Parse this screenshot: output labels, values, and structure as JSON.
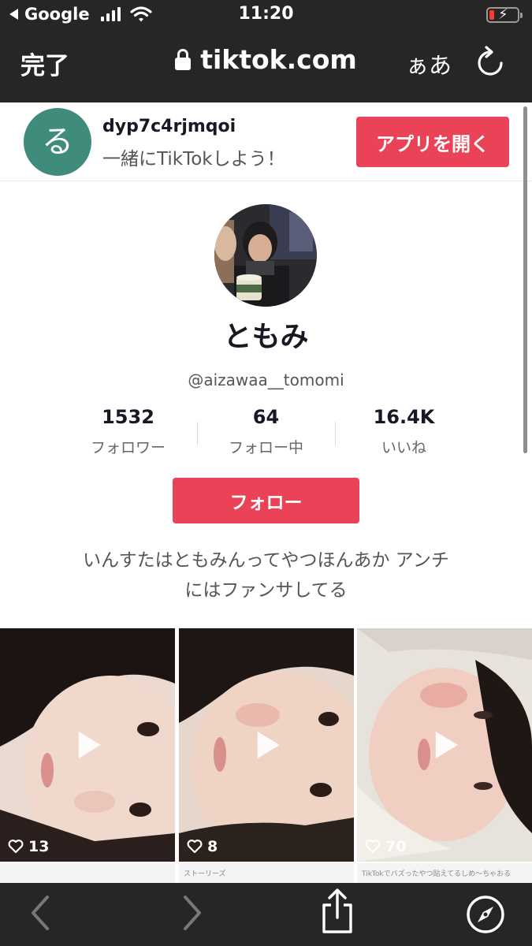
{
  "status_bar": {
    "back_app": "Google",
    "time": "11:20"
  },
  "safari": {
    "done_label": "完了",
    "url": "tiktok.com",
    "text_size_label": "ぁあ"
  },
  "banner": {
    "avatar_char": "る",
    "username": "dyp7c4rjmqoi",
    "subtitle": "一緒にTikTokしよう！",
    "open_app_label": "アプリを開く"
  },
  "profile": {
    "name": "ともみ",
    "handle": "@aizawaa__tomomi",
    "stats": [
      {
        "value": "1532",
        "label": "フォロワー"
      },
      {
        "value": "64",
        "label": "フォロー中"
      },
      {
        "value": "16.4K",
        "label": "いいね"
      }
    ],
    "follow_label": "フォロー",
    "bio_line1": "いんすたはともみんってやつほんあか アンチ",
    "bio_line2": "にはファンサしてる"
  },
  "videos": [
    {
      "likes": "13"
    },
    {
      "likes": "8"
    },
    {
      "likes": "70"
    }
  ],
  "below_strips": [
    "",
    "ストーリーズ",
    "TikTokでバズったやつ貼えてるしめ〜ちゃおる"
  ],
  "colors": {
    "accent": "#ea4357",
    "chrome": "#262626",
    "banner_avatar": "#3f8c7c"
  },
  "icons": [
    "signal-icon",
    "wifi-icon",
    "battery-icon",
    "lock-icon",
    "reload-icon",
    "heart-icon",
    "play-icon",
    "back-arrow-icon",
    "forward-arrow-icon",
    "share-icon",
    "compass-icon"
  ]
}
